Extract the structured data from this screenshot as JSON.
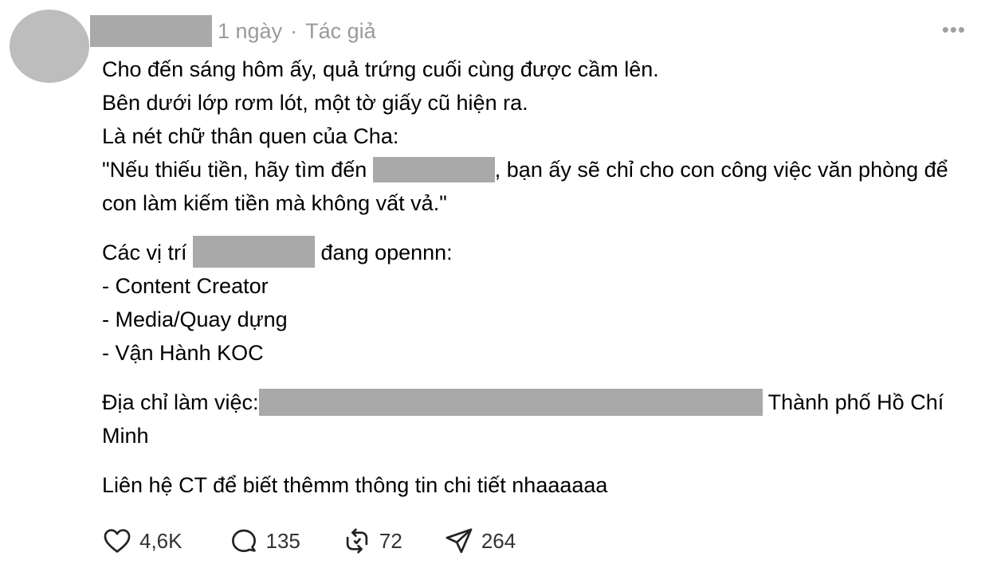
{
  "post": {
    "time": "1 ngày",
    "separator": "·",
    "author_badge": "Tác giả",
    "more_label": "•••",
    "lines": {
      "l1": "Cho đến sáng hôm ấy, quả trứng cuối cùng được cầm lên.",
      "l2": "Bên dưới lớp rơm lót, một tờ giấy cũ hiện ra.",
      "l3": "Là nét chữ thân quen của Cha:",
      "l4a": "\"Nếu thiếu tiền, hãy tìm đến ",
      "l4b": ", bạn ấy sẽ chỉ cho con công việc văn phòng để con làm kiếm tiền mà không vất vả.\"",
      "l5a": "Các vị trí ",
      "l5b": " đang opennn:",
      "l6": "- Content Creator",
      "l7": "- Media/Quay dựng",
      "l8": "- Vận Hành KOC",
      "l9a": "Địa chỉ làm việc:",
      "l9b": " Thành phố Hồ Chí Minh",
      "l10": "Liên hệ CT để biết thêmm thông tin chi tiết nhaaaaaa"
    },
    "actions": {
      "likes": "4,6K",
      "replies": "135",
      "reposts": "72",
      "shares": "264"
    }
  },
  "icons": {
    "like": "heart-icon",
    "reply": "comment-bubble-icon",
    "repost": "repost-arrows-icon",
    "share": "send-paper-plane-icon",
    "more": "more-horizontal-icon"
  },
  "colors": {
    "redaction": "#a9a9a9",
    "avatar": "#bdbdbd",
    "meta_text": "#9a9a9a"
  }
}
